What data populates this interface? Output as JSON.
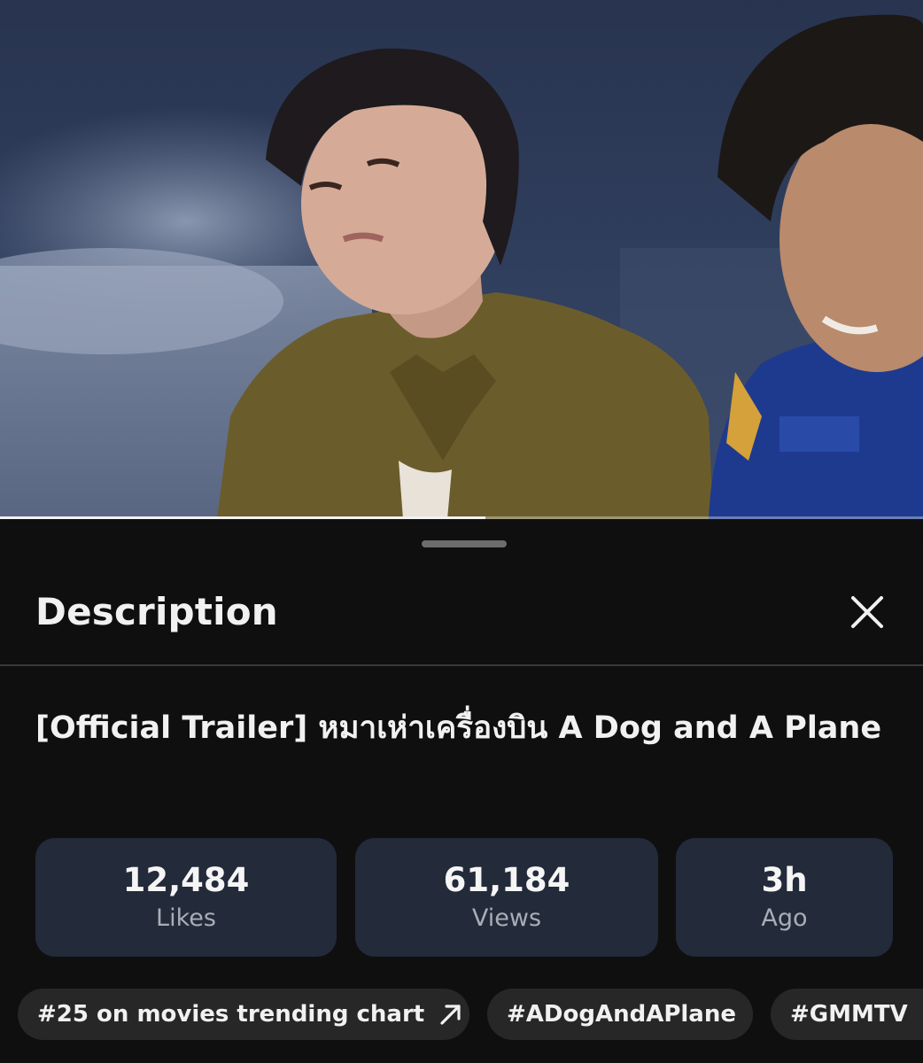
{
  "player": {
    "progress_fraction": 0.526
  },
  "description_sheet": {
    "title": "Description",
    "close_icon": "close-icon",
    "video_title": "[Official Trailer] หมาเห่าเครื่องบิน A Dog and A Plane",
    "stats": [
      {
        "value": "12,484",
        "label": "Likes"
      },
      {
        "value": "61,184",
        "label": "Views"
      },
      {
        "value": "3h",
        "label": "Ago"
      }
    ],
    "chips": [
      {
        "label": "#25 on movies trending chart",
        "icon": "arrow-up-right-icon"
      },
      {
        "label": "#ADogAndAPlane"
      },
      {
        "label": "#GMMTV"
      }
    ]
  },
  "colors": {
    "background": "#0f0f0f",
    "stat_card": "#232a3a",
    "chip": "#272727",
    "progress": "#f2f2f2"
  }
}
